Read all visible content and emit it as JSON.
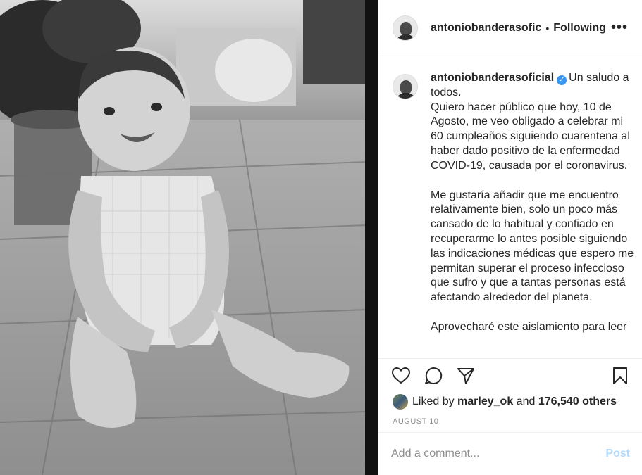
{
  "header": {
    "username": "antoniobanderasofic",
    "separator": "•",
    "follow_status": "Following",
    "more": "•••"
  },
  "caption": {
    "username": "antoniobanderasoficial",
    "verified_glyph": "✓",
    "intro": "Un saludo a todos.",
    "paragraph1": "Quiero hacer público que hoy, 10 de Agosto, me veo obligado a celebrar mi 60 cumpleaños siguiendo cuarentena al haber dado positivo de la enfermedad COVID-19, causada por el coronavirus.",
    "paragraph2": "Me gustaría añadir que me encuentro relativamente bien, solo un poco más cansado de lo habitual y confiado en recuperarme lo antes posible siguiendo las indicaciones médicas que espero me permitan superar el proceso infeccioso que sufro y que a tantas personas está afectando alrededor del planeta.",
    "paragraph3": "Aprovecharé este aislamiento para leer"
  },
  "actions": {
    "icons": [
      "heart-icon",
      "comment-icon",
      "share-icon",
      "bookmark-icon"
    ]
  },
  "likes": {
    "prefix": "Liked by",
    "liker": "marley_ok",
    "and": "and",
    "others": "176,540 others"
  },
  "date": "AUGUST 10",
  "comment": {
    "placeholder": "Add a comment...",
    "post_label": "Post"
  },
  "colors": {
    "verified": "#3897f0",
    "post_disabled": "#b3dbff",
    "muted": "#8e8e8e"
  }
}
